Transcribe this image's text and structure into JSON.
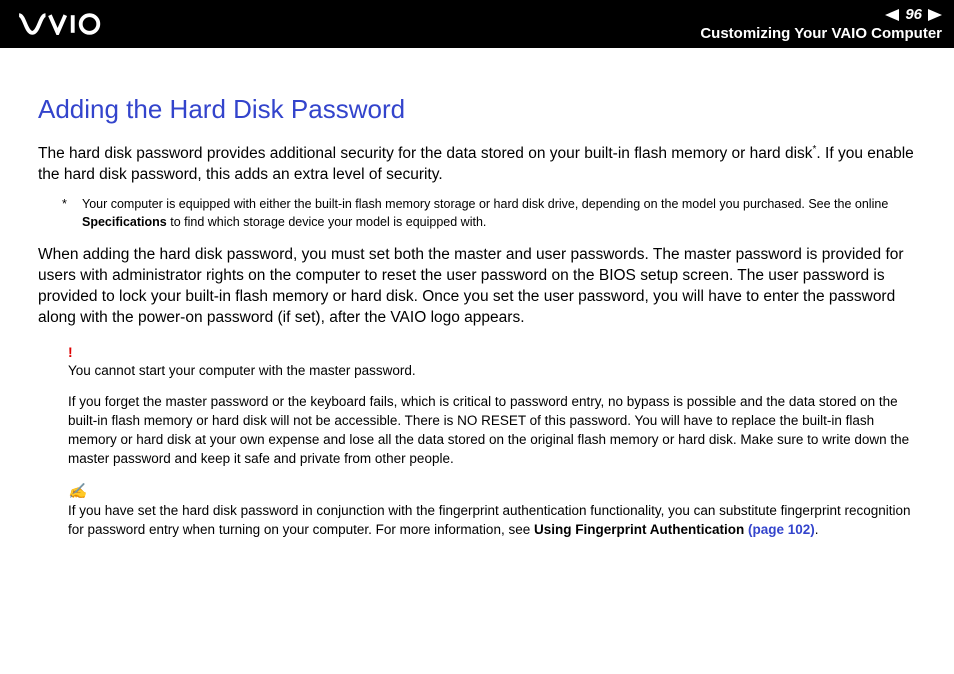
{
  "header": {
    "page_number": "96",
    "section": "Customizing Your VAIO Computer"
  },
  "title": "Adding the Hard Disk Password",
  "intro_a": "The hard disk password provides additional security for the data stored on your built-in flash memory or hard disk",
  "intro_b": ". If you enable the hard disk password, this adds an extra level of security.",
  "footnote_star": "*",
  "footnote_a": "Your computer is equipped with either the built-in flash memory storage or hard disk drive, depending on the model you purchased. See the online ",
  "footnote_spec": "Specifications",
  "footnote_b": " to find which storage device your model is equipped with.",
  "para2": "When adding the hard disk password, you must set both the master and user passwords. The master password is provided for users with administrator rights on the computer to reset the user password on the BIOS setup screen. The user password is provided to lock your built-in flash memory or hard disk. Once you set the user password, you will have to enter the password along with the power-on password (if set), after the VAIO logo appears.",
  "warn_marker": "!",
  "warn1": "You cannot start your computer with the master password.",
  "warn2": "If you forget the master password or the keyboard fails, which is critical to password entry, no bypass is possible and the data stored on the built-in flash memory or hard disk will not be accessible. There is NO RESET of this password. You will have to replace the built-in flash memory or hard disk at your own expense and lose all the data stored on the original flash memory or hard disk. Make sure to write down the master password and keep it safe and private from other people.",
  "tip_marker": "✍",
  "tip_a": "If you have set the hard disk password in conjunction with the fingerprint authentication functionality, you can substitute fingerprint recognition for password entry when turning on your computer. For more information, see ",
  "tip_link": "Using Fingerprint Authentication",
  "tip_pageref": " (page 102)",
  "tip_period": "."
}
